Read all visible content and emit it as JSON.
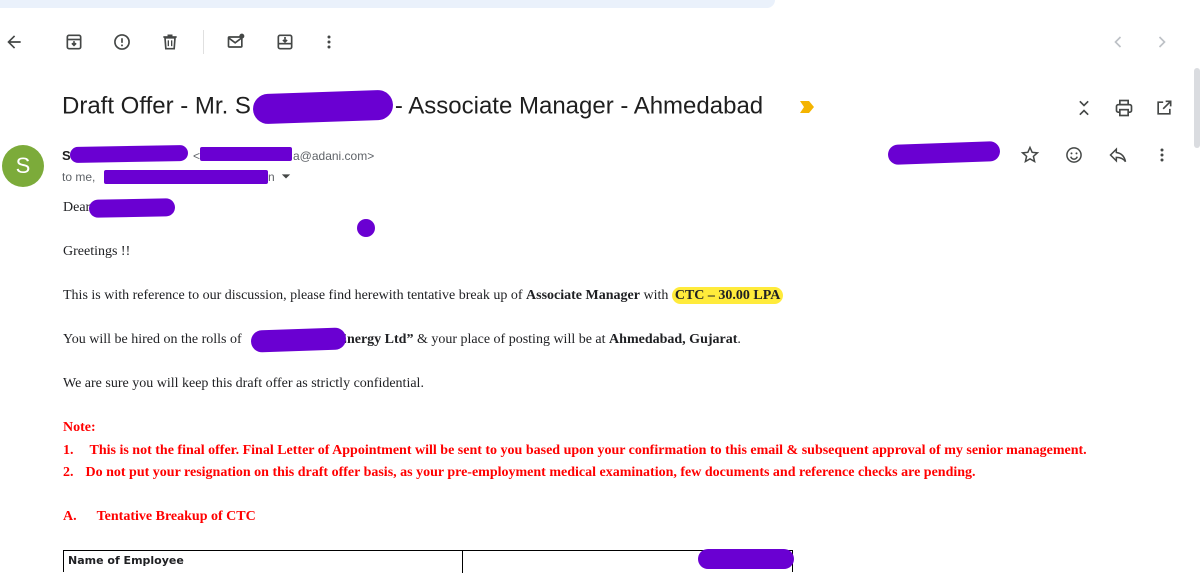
{
  "toolbar": {
    "icons": [
      "back-icon",
      "archive-icon",
      "report-spam-icon",
      "delete-icon",
      "mark-unread-icon",
      "move-to-icon",
      "more-vert-icon",
      "newer-icon",
      "older-icon"
    ]
  },
  "email": {
    "subject_prefix": "Draft Offer - Mr. S",
    "subject_suffix": "- Associate Manager - Ahmedabad",
    "sender_initial": "S",
    "sender_name_start": "S",
    "sender_email_start": "<",
    "sender_email_end": "a@adani.com>",
    "recipients_prefix": "to me, ",
    "recipients_suffix": "n",
    "body": {
      "salutation": "Dear",
      "greeting": "Greetings !!",
      "para1_pre": "This is with reference to our discussion, please find herewith tentative break up of ",
      "para1_role": "Associate Manager",
      "para1_mid": " with ",
      "para1_ctc": "CTC – 30.00 LPA",
      "para2_pre": "You will be hired on the rolls of",
      "para2_company": "Energy Ltd”",
      "para2_mid": " & your place of posting will be at ",
      "para2_location": "Ahmedabad, Gujarat",
      "para2_end": ".",
      "para3": "We are sure you will keep this draft offer as strictly confidential.",
      "note_title": "Note:",
      "note_1_num": "1.",
      "note_1": "This is not the final offer. Final Letter of Appointment will be sent to you based upon your confirmation to this email & subsequent approval of my senior management.",
      "note_2_num": "2.",
      "note_2": "Do not put your resignation on this draft offer basis, as your pre-employment medical examination, few documents and reference checks are pending.",
      "section_a_num": "A.",
      "section_a_title": "Tentative Breakup of CTC",
      "table_header": "Name of Employee"
    }
  },
  "colors": {
    "redaction": "#6a00d2",
    "highlight": "#ffeb3b",
    "note_red": "#ff0000",
    "avatar_bg": "#7cab3a",
    "tag_arrow": "#f4b400"
  }
}
